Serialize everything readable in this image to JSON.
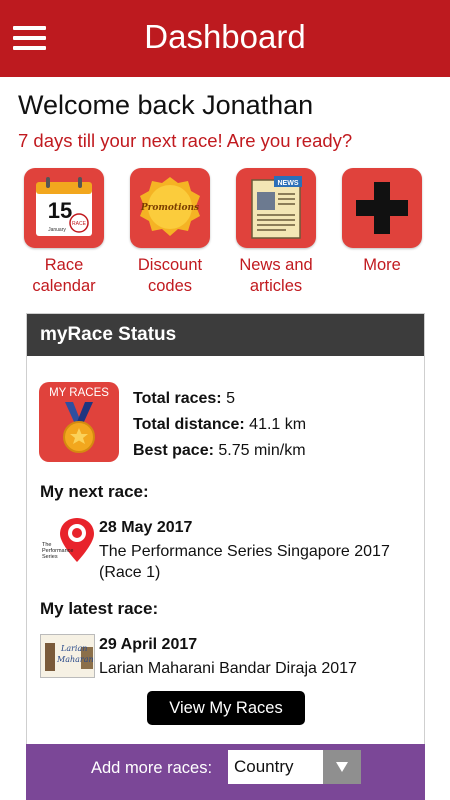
{
  "header": {
    "title": "Dashboard",
    "menu_icon": "hamburger-menu-icon"
  },
  "welcome": {
    "greeting": "Welcome back Jonathan",
    "countdown": "7 days till your next race! Are you ready?"
  },
  "tiles": [
    {
      "label_line1": "Race",
      "label_line2": "calendar",
      "icon": "calendar-icon",
      "calendar_day": "15",
      "calendar_month": "January",
      "calendar_stamp": "RACE"
    },
    {
      "label_line1": "Discount",
      "label_line2": "codes",
      "icon": "promotions-badge-icon",
      "badge_text": "Promotions"
    },
    {
      "label_line1": "News and",
      "label_line2": "articles",
      "icon": "newspaper-icon",
      "news_tag": "NEWS"
    },
    {
      "label_line1": "More",
      "label_line2": "",
      "icon": "plus-icon"
    }
  ],
  "status": {
    "title": "myRace Status",
    "badge_text": "MY RACES",
    "badge_icon": "medal-icon",
    "total_races_label": "Total races:",
    "total_races_value": "5",
    "total_distance_label": "Total distance:",
    "total_distance_value": "41.1 km",
    "best_pace_label": "Best pace:",
    "best_pace_value": "5.75 min/km",
    "next_race_title": "My next race:",
    "next_race": {
      "date": "28 May 2017",
      "name": "The Performance Series Singapore 2017 (Race 1)",
      "logo_line1": "The",
      "logo_line2": "Performance",
      "logo_line3": "Series"
    },
    "latest_race_title": "My latest race:",
    "latest_race": {
      "date": "29 April 2017",
      "name": "Larian Maharani Bandar Diraja 2017",
      "logo_line1": "Larian",
      "logo_line2": "Maharani"
    },
    "view_button": "View My Races"
  },
  "add_races": {
    "label": "Add more races:",
    "country_value": "Country"
  },
  "colors": {
    "brand_red": "#bd1a1f",
    "tile_red": "#e0423c",
    "header_dark": "#3c3c3c",
    "purple": "#7b4797"
  }
}
